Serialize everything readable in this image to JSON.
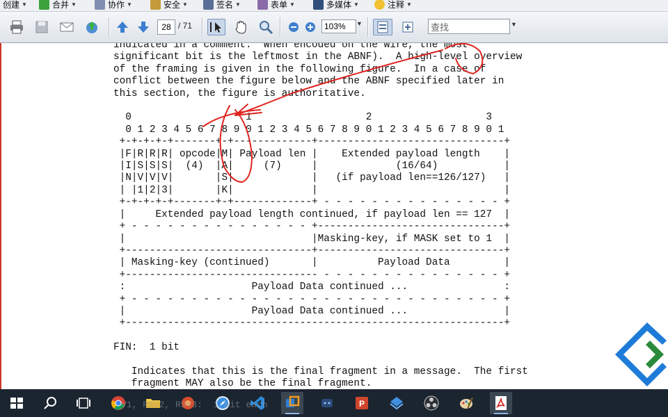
{
  "menu": {
    "items": [
      {
        "label": "创建"
      },
      {
        "label": "合并"
      },
      {
        "label": "协作"
      },
      {
        "label": "安全"
      },
      {
        "label": "签名"
      },
      {
        "label": "表单"
      },
      {
        "label": "多媒体"
      },
      {
        "label": "注释"
      }
    ]
  },
  "toolbar": {
    "page_current": "28",
    "page_total": "/ 71",
    "zoom": "103%",
    "search_placeholder": "查找"
  },
  "document": {
    "text": "indicated in a comment.  When encoded on the wire, the most\nsignificant bit is the leftmost in the ABNF).  A high-level overview\nof the framing is given in the following figure.  In a case of\nconflict between the figure below and the ABNF specified later in\nthis section, the figure is authoritative.\n\n  0                   1                   2                   3\n  0 1 2 3 4 5 6 7 8 9 0 1 2 3 4 5 6 7 8 9 0 1 2 3 4 5 6 7 8 9 0 1\n +-+-+-+-+-------+-+-------------+-------------------------------+\n |F|R|R|R| opcode|M| Payload len |    Extended payload length    |\n |I|S|S|S|  (4)  |A|     (7)     |             (16/64)           |\n |N|V|V|V|       |S|             |   (if payload len==126/127)   |\n | |1|2|3|       |K|             |                               |\n +-+-+-+-+-------+-+-------------+ - - - - - - - - - - - - - - - +\n |     Extended payload length continued, if payload len == 127  |\n + - - - - - - - - - - - - - - - +-------------------------------+\n |                               |Masking-key, if MASK set to 1  |\n +-------------------------------+-------------------------------+\n | Masking-key (continued)       |          Payload Data         |\n +-------------------------------- - - - - - - - - - - - - - - - +\n :                     Payload Data continued ...                :\n + - - - - - - - - - - - - - - - - - - - - - - - - - - - - - - - +\n |                     Payload Data continued ...                |\n +---------------------------------------------------------------+\n\nFIN:  1 bit\n\n   Indicates that this is the final fragment in a message.  The first\n   fragment MAY also be the final fragment."
  },
  "taskbar": {
    "apps": [
      "start-icon",
      "search-icon",
      "task-view-icon",
      "chrome-icon",
      "file-explorer-icon",
      "browser-icon",
      "safari-icon",
      "vscode-icon",
      "app-icon",
      "github-desktop-icon",
      "powerpoint-icon",
      "app-icon-2",
      "obs-icon",
      "paint-icon",
      "acrobat-icon"
    ],
    "ghost_text": "V1, RSV2, RSV3:  1 bit each"
  },
  "colors": {
    "ink_annotation": "#e0231e",
    "taskbar": "#1b2530",
    "logo": "#1e7bd8"
  }
}
